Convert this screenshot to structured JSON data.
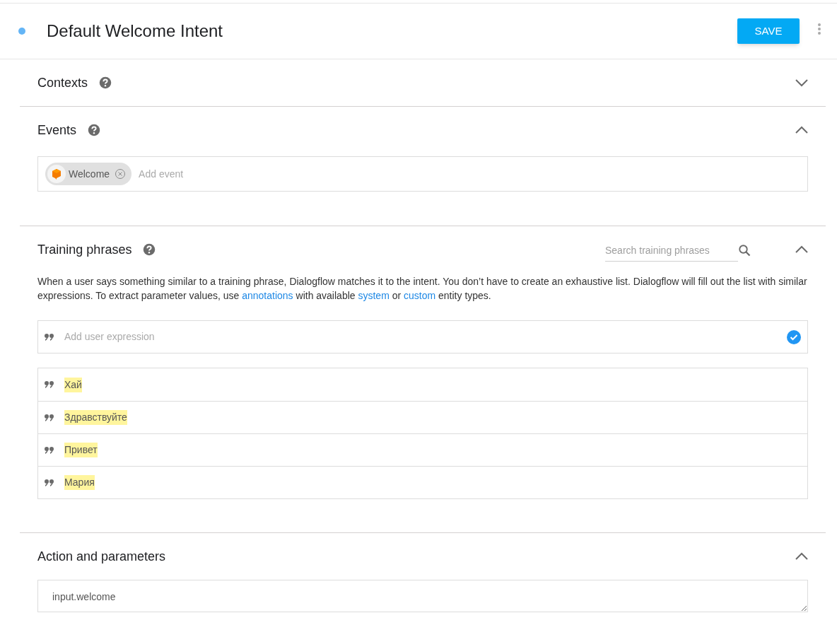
{
  "header": {
    "title": "Default Welcome Intent",
    "save_button": "SAVE"
  },
  "sections": [
    {
      "kind": "contexts",
      "title": "Contexts",
      "help": true,
      "expanded": false
    },
    {
      "kind": "events",
      "title": "Events",
      "help": true,
      "expanded": true,
      "chips": [
        "Welcome"
      ],
      "placeholder": "Add event"
    },
    {
      "kind": "training",
      "title": "Training phrases",
      "help": true,
      "expanded": true,
      "search_placeholder": "Search training phrases",
      "description": [
        {
          "kind": "text",
          "text": "When a user says something similar to a training phrase, Dialogflow matches it to the intent. You don’t have to create an exhaustive list. Dialogflow will fill out the list with similar expressions. To extract parameter values, use "
        },
        {
          "kind": "link",
          "text": "annotations"
        },
        {
          "kind": "text",
          "text": " with available "
        },
        {
          "kind": "link",
          "text": "system"
        },
        {
          "kind": "text",
          "text": " or "
        },
        {
          "kind": "link",
          "text": "custom"
        },
        {
          "kind": "text",
          "text": " entity types."
        }
      ],
      "input_placeholder": "Add user expression",
      "phrases": [
        "Хай",
        "Здравствуйте",
        "Привет",
        "Мария"
      ]
    },
    {
      "kind": "action",
      "title": "Action and parameters",
      "help": false,
      "expanded": true,
      "value": "input.welcome"
    }
  ]
}
